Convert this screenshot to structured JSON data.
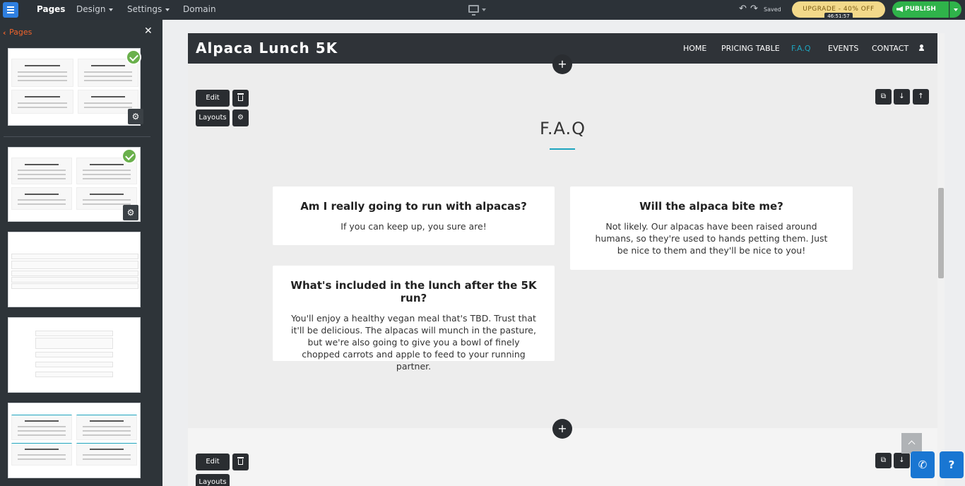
{
  "topbar": {
    "nav": [
      {
        "label": "Pages"
      },
      {
        "label": "Design"
      },
      {
        "label": "Settings"
      },
      {
        "label": "Domain"
      }
    ],
    "saved_text": "Saved",
    "upgrade_label": "UPGRADE - 40% OFF",
    "timer": "46:51:57",
    "publish_label": "PUBLISH",
    "colors": {
      "bar": "#2c3238",
      "upgrade": "#f3d98a",
      "publish": "#2fb34a"
    }
  },
  "sidebar": {
    "title": "Pages",
    "close_icon": "close-icon",
    "thumbnails": [
      {
        "cards": [
          "Do you need an effective FAQ list?",
          "When do you want your clients to know?",
          "Do you need an effective FAQ list?",
          "Got questions that need answering?"
        ]
      },
      {
        "cards": [
          "Do you need an effective FAQ list?",
          "What do you want your clients to know?",
          "Do you need an effective FAQ list?",
          "Got questions that need answering?"
        ]
      }
    ]
  },
  "site": {
    "logo": "Alpaca Lunch 5K",
    "nav": [
      {
        "label": "HOME"
      },
      {
        "label": "PRICING TABLE"
      },
      {
        "label": "F.A.Q"
      },
      {
        "label": "EVENTS"
      },
      {
        "label": "CONTACT"
      }
    ],
    "active_color": "#1ea5bf"
  },
  "controls": {
    "edit_label": "Edit",
    "layouts_label": "Layouts"
  },
  "section": {
    "title": "F.A.Q",
    "faqs": [
      {
        "question": "Am I really going to run with alpacas?",
        "answer": "If you can keep up, you sure are!"
      },
      {
        "question": "Will the alpaca bite me?",
        "answer": "Not likely. Our alpacas have been raised around humans, so they're used to hands petting them. Just be nice to them and they'll be nice to you!"
      },
      {
        "question": "What's included in the lunch after the 5K run?",
        "answer": "You'll enjoy a healthy vegan meal that's TBD. Trust that it'll be delicious. The alpacas will munch in the pasture, but we're also going to give you a bowl of finely chopped carrots and apple to feed to your running partner."
      }
    ]
  },
  "help": {
    "phone_icon": "phone-icon",
    "question_label": "?"
  }
}
